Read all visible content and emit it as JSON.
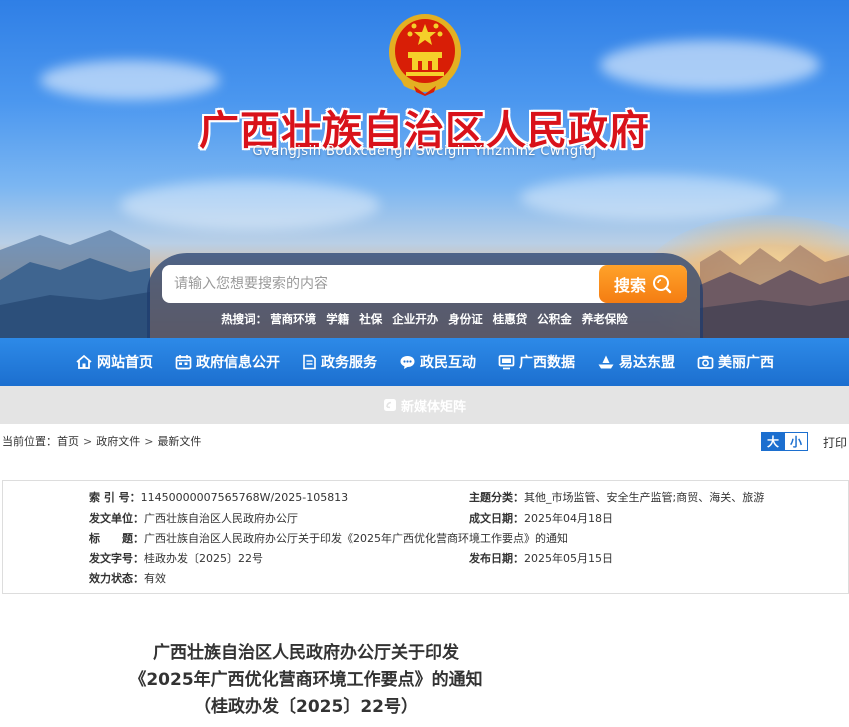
{
  "header": {
    "title": "广西壮族自治区人民政府",
    "subtitle": "Gvangjsih Bouxcuengh Swcigih Yinzminz Cwngfuj"
  },
  "search": {
    "placeholder": "请输入您想要搜索的内容",
    "button_label": "搜索",
    "hot_label": "热搜词：",
    "hot_words": [
      "营商环境",
      "学籍",
      "社保",
      "企业开办",
      "身份证",
      "桂惠贷",
      "公积金",
      "养老保险"
    ]
  },
  "nav": {
    "items": [
      {
        "label": "网站首页",
        "icon": "home-icon"
      },
      {
        "label": "政府信息公开",
        "icon": "calendar-icon"
      },
      {
        "label": "政务服务",
        "icon": "document-icon"
      },
      {
        "label": "政民互动",
        "icon": "chat-icon"
      },
      {
        "label": "广西数据",
        "icon": "monitor-icon"
      },
      {
        "label": "易达东盟",
        "icon": "ship-icon"
      },
      {
        "label": "美丽广西",
        "icon": "camera-icon"
      }
    ]
  },
  "media_bar": {
    "label": "新媒体矩阵",
    "icon": "media-icon"
  },
  "breadcrumb": {
    "prefix": "当前位置：",
    "items": [
      "首页",
      "政府文件",
      "最新文件"
    ],
    "separator": ">"
  },
  "tools": {
    "large_label": "大",
    "small_label": "小",
    "print_label": "打印"
  },
  "info": {
    "index_label": "索 引 号：",
    "index_value": "11450000007565768W/2025-105813",
    "subject_label": "主题分类：",
    "subject_value": "其他_市场监管、安全生产监管;商贸、海关、旅游",
    "issuer_label": "发文单位：",
    "issuer_value": "广西壮族自治区人民政府办公厅",
    "written_label": "成文日期：",
    "written_value": "2025年04月18日",
    "title_label": "标　　题：",
    "title_value": "广西壮族自治区人民政府办公厅关于印发《2025年广西优化营商环境工作要点》的通知",
    "docno_label": "发文字号：",
    "docno_value": "桂政办发〔2025〕22号",
    "published_label": "发布日期：",
    "published_value": "2025年05月15日",
    "status_label": "效力状态：",
    "status_value": "有效"
  },
  "document": {
    "title_line1": "广西壮族自治区人民政府办公厅关于印发",
    "title_line2": "《2025年广西优化营商环境工作要点》的通知",
    "title_line3": "（桂政办发〔2025〕22号）"
  },
  "colors": {
    "title_red": "#d9121a",
    "nav_blue": "#1c6fcf",
    "search_orange": "#f47d12"
  }
}
